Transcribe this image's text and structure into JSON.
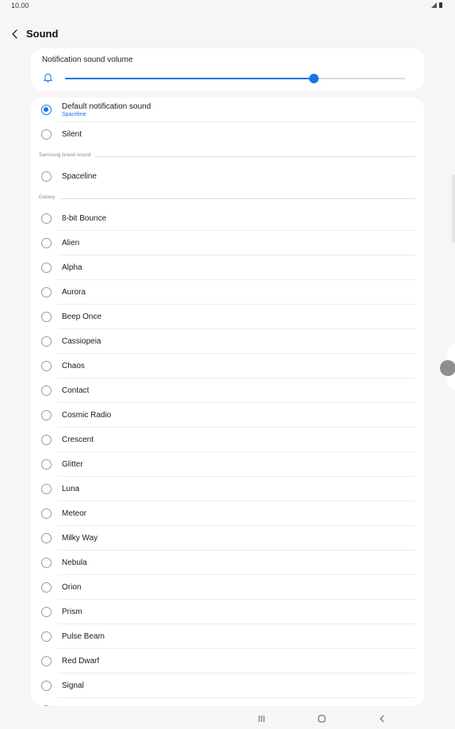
{
  "status_bar": {
    "time": "10.00"
  },
  "header": {
    "title": "Sound"
  },
  "volume": {
    "label": "Notification sound volume",
    "level": 0.73
  },
  "default_sound": {
    "label": "Default notification sound",
    "value": "Spaceline"
  },
  "silent_label": "Silent",
  "sections": [
    {
      "label": "Samsung brand sound",
      "items": [
        "Spaceline"
      ]
    },
    {
      "label": "Galaxy",
      "items": [
        "8-bit Bounce",
        "Alien",
        "Alpha",
        "Aurora",
        "Beep Once",
        "Cassiopeia",
        "Chaos",
        "Contact",
        "Cosmic Radio",
        "Crescent",
        "Glitter",
        "Luna",
        "Meteor",
        "Milky Way",
        "Nebula",
        "Orion",
        "Prism",
        "Pulse Beam",
        "Red Dwarf",
        "Signal"
      ]
    }
  ],
  "colors": {
    "accent": "#1a73e8",
    "background": "#f6f6f6",
    "card": "#ffffff"
  }
}
